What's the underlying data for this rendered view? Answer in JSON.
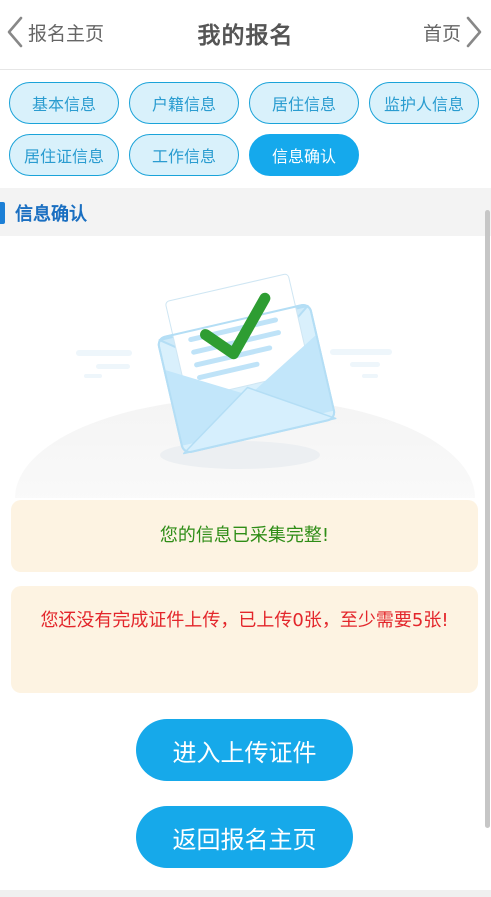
{
  "header": {
    "back_label": "报名主页",
    "title": "我的报名",
    "home_label": "首页"
  },
  "tabs": [
    {
      "label": "基本信息",
      "active": false
    },
    {
      "label": "户籍信息",
      "active": false
    },
    {
      "label": "居住信息",
      "active": false
    },
    {
      "label": "监护人信息",
      "active": false
    },
    {
      "label": "居住证信息",
      "active": false
    },
    {
      "label": "工作信息",
      "active": false
    },
    {
      "label": "信息确认",
      "active": true
    }
  ],
  "section": {
    "title": "信息确认"
  },
  "illustration": {
    "icon": "envelope-check-icon"
  },
  "messages": {
    "complete": "您的信息已采集完整!",
    "warning": "您还没有完成证件上传，已上传0张，至少需要5张!"
  },
  "buttons": {
    "upload": "进入上传证件",
    "back": "返回报名主页"
  },
  "colors": {
    "accent": "#15a9ec",
    "section_title": "#1a6fc1",
    "success_text": "#2f8d17",
    "warning_text": "#e3262b",
    "message_bg": "#fdf3e2"
  }
}
